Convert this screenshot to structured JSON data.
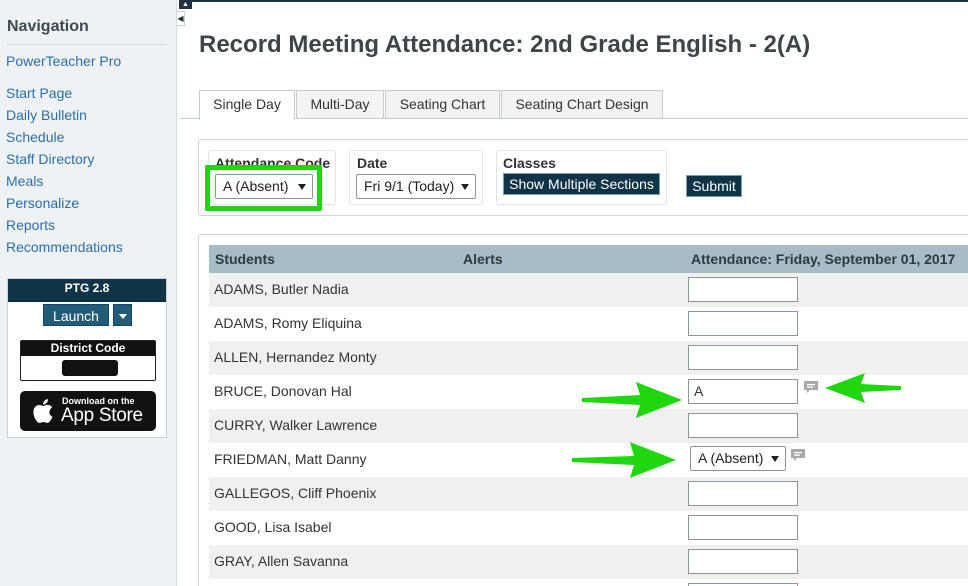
{
  "colors": {
    "nav_link": "#2a6fa8",
    "header_dark": "#0f3347",
    "table_header": "#a7bcc6",
    "highlight_green": "#20d60f"
  },
  "sidebar": {
    "heading": "Navigation",
    "items": [
      {
        "label": "PowerTeacher Pro"
      },
      {
        "label": "Start Page"
      },
      {
        "label": "Daily Bulletin"
      },
      {
        "label": "Schedule"
      },
      {
        "label": "Staff Directory"
      },
      {
        "label": "Meals"
      },
      {
        "label": "Personalize"
      },
      {
        "label": "Reports"
      },
      {
        "label": "Recommendations"
      }
    ],
    "ptg": {
      "title": "PTG 2.8",
      "launch_label": "Launch",
      "district_code_label": "District Code",
      "appstore_small": "Download on the",
      "appstore_big": "App Store"
    }
  },
  "page": {
    "title": "Record Meeting Attendance: 2nd Grade English - 2(A)"
  },
  "tabs": [
    {
      "label": "Single Day",
      "active": true
    },
    {
      "label": "Multi-Day",
      "active": false
    },
    {
      "label": "Seating Chart",
      "active": false
    },
    {
      "label": "Seating Chart Design",
      "active": false
    }
  ],
  "filters": {
    "attendance_code_label": "Attendance Code",
    "attendance_code_value": "A (Absent)",
    "date_label": "Date",
    "date_value": "Fri 9/1 (Today)",
    "classes_label": "Classes",
    "show_multiple_label": "Show Multiple Sections",
    "submit_label": "Submit"
  },
  "table": {
    "headers": {
      "students": "Students",
      "alerts": "Alerts",
      "attendance": "Attendance: Friday, September 01, 2017"
    },
    "rows": [
      {
        "name": "ADAMS, Butler Nadia",
        "value": "",
        "control": "input",
        "comment": false
      },
      {
        "name": "ADAMS, Romy Eliquina",
        "value": "",
        "control": "input",
        "comment": false
      },
      {
        "name": "ALLEN, Hernandez Monty",
        "value": "",
        "control": "input",
        "comment": false
      },
      {
        "name": "BRUCE, Donovan Hal",
        "value": "A",
        "control": "input",
        "comment": true
      },
      {
        "name": "CURRY, Walker Lawrence",
        "value": "",
        "control": "input",
        "comment": false
      },
      {
        "name": "FRIEDMAN, Matt Danny",
        "value": "A (Absent)",
        "control": "select",
        "comment": true
      },
      {
        "name": "GALLEGOS, Cliff Phoenix",
        "value": "",
        "control": "input",
        "comment": false
      },
      {
        "name": "GOOD, Lisa Isabel",
        "value": "",
        "control": "input",
        "comment": false
      },
      {
        "name": "GRAY, Allen Savanna",
        "value": "",
        "control": "input",
        "comment": false
      }
    ]
  },
  "icons": [
    "collapse-arrow-icon",
    "apple-logo-icon",
    "chevron-down-icon",
    "comment-icon",
    "green-arrow-annotation"
  ]
}
